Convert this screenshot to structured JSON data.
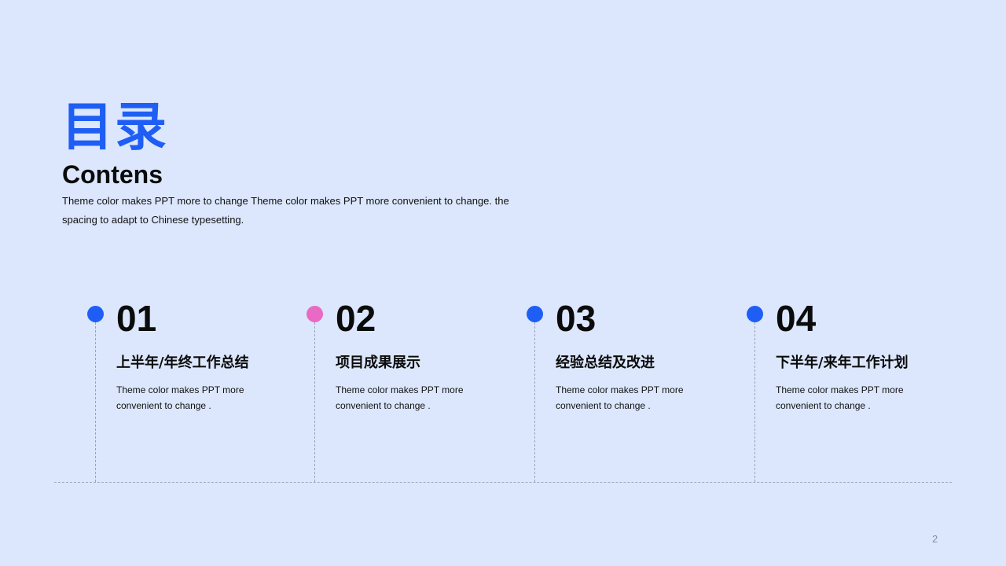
{
  "header": {
    "title_cn": "目录",
    "title_en": "Contens",
    "subtitle": "Theme  color makes PPT more to change  Theme  color makes PPT more convenient  to change.  the spacing  to adapt to Chinese  typesetting."
  },
  "colors": {
    "background": "#dce7fd",
    "accent_blue": "#1f5ef5",
    "accent_pink": "#e86ac2",
    "dashed_line": "#9aa4b8"
  },
  "items": [
    {
      "number": "01",
      "heading": "上半年/年终工作总结",
      "description": "Theme  color makes PPT more convenient to change .",
      "dot_color": "#1f5ef5"
    },
    {
      "number": "02",
      "heading": "项目成果展示",
      "description": "Theme  color makes PPT more convenient to change .",
      "dot_color": "#e86ac2"
    },
    {
      "number": "03",
      "heading": "经验总结及改进",
      "description": "Theme  color makes PPT more convenient to change .",
      "dot_color": "#1f5ef5"
    },
    {
      "number": "04",
      "heading": "下半年/来年工作计划",
      "description": "Theme  color makes PPT more convenient to change .",
      "dot_color": "#1f5ef5"
    }
  ],
  "footer": {
    "page_number": "2"
  }
}
